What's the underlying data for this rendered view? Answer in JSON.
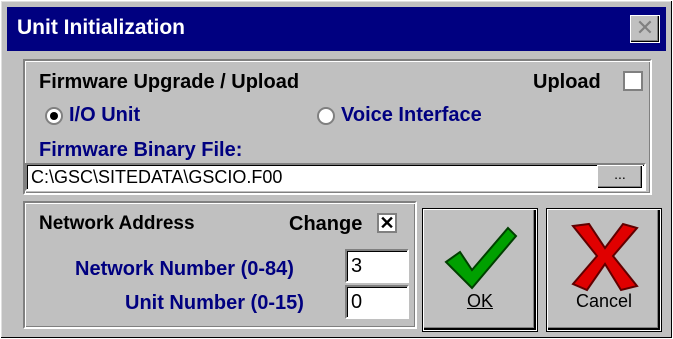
{
  "dialog": {
    "title": "Unit Initialization"
  },
  "firmware": {
    "group_label": "Firmware Upgrade / Upload",
    "upload_label": "Upload",
    "upload_checked": false,
    "radio_io": "I/O Unit",
    "radio_voice": "Voice Interface",
    "selected": "I/O Unit",
    "file_label": "Firmware Binary File:",
    "file_value": "C:\\GSC\\SITEDATA\\GSCIO.F00",
    "browse_label": "..."
  },
  "network": {
    "group_label": "Network Address",
    "change_label": "Change",
    "change_checked": true,
    "net_number_label": "Network Number (0-84)",
    "net_number_value": "3",
    "unit_number_label": "Unit Number (0-15)",
    "unit_number_value": "0"
  },
  "buttons": {
    "ok_label": "OK",
    "cancel_label": "Cancel"
  },
  "colors": {
    "title_bar": "#000080",
    "ok_icon": "#00a000",
    "cancel_icon": "#e00000"
  }
}
